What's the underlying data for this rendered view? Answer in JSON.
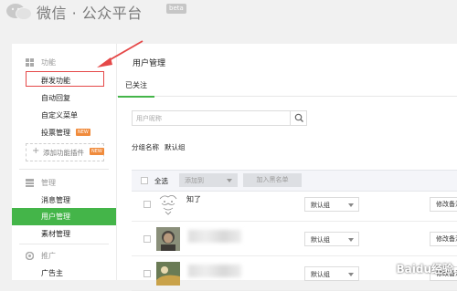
{
  "header": {
    "title": "微信 · 公众平台",
    "beta": "beta"
  },
  "sidebar": {
    "sections": [
      {
        "name": "功能",
        "icon": "grid-icon",
        "items": [
          {
            "label": "群发功能",
            "highlighted": true
          },
          {
            "label": "自动回复"
          },
          {
            "label": "自定义菜单"
          },
          {
            "label": "投票管理",
            "badge": "NEW"
          }
        ],
        "add_plugin": "添加功能插件",
        "add_plugin_badge": "NEW"
      },
      {
        "name": "管理",
        "icon": "manage-icon",
        "items": [
          {
            "label": "消息管理"
          },
          {
            "label": "用户管理",
            "active": true
          },
          {
            "label": "素材管理"
          }
        ]
      },
      {
        "name": "推广",
        "icon": "promo-icon",
        "items": [
          {
            "label": "广告主"
          }
        ]
      }
    ]
  },
  "main": {
    "title": "用户管理",
    "tabs": [
      {
        "label": "已关注",
        "active": true
      }
    ],
    "search": {
      "placeholder": "用户昵称"
    },
    "group": {
      "label": "分组名称",
      "value": "默认组"
    },
    "toolbar": {
      "select_all": "全选",
      "add_to": "添加到",
      "blacklist": "加入黑名单"
    },
    "users": [
      {
        "nickname": "知了",
        "group": "默认组",
        "remark": "修改备注"
      },
      {
        "nickname": "",
        "group": "默认组",
        "remark": "修改备注"
      },
      {
        "nickname": "",
        "group": "默认组",
        "remark": "修改备注"
      }
    ]
  },
  "watermark": "Baidu经验",
  "colors": {
    "accent": "#44b549",
    "annotation": "#e54848"
  }
}
